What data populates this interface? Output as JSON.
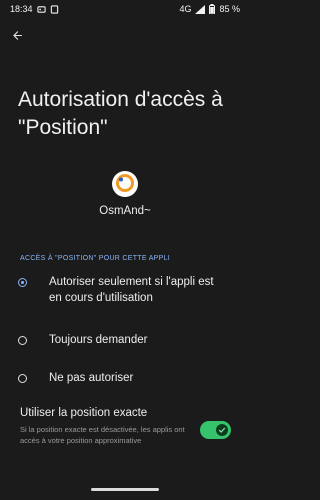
{
  "status": {
    "time": "18:34",
    "network": "4G",
    "battery": "85 %"
  },
  "page": {
    "title": "Autorisation d'accès à \"Position\""
  },
  "app": {
    "name": "OsmAnd~",
    "icon": "osmand-icon"
  },
  "section": {
    "label": "ACCÈS À \"POSITION\" POUR CETTE APPLI"
  },
  "options": [
    {
      "label": "Autoriser seulement si l'appli est en cours d'utilisation",
      "selected": true
    },
    {
      "label": "Toujours demander",
      "selected": false
    },
    {
      "label": "Ne pas autoriser",
      "selected": false
    }
  ],
  "exact_location": {
    "title": "Utiliser la position exacte",
    "description": "Si la position exacte est désactivée, les applis ont accès à votre position approximative",
    "enabled": true
  },
  "colors": {
    "background": "#1b1b1b",
    "accent": "#8ab4f8",
    "toggle_on": "#35c46b",
    "osmand_orange": "#f29b24"
  }
}
